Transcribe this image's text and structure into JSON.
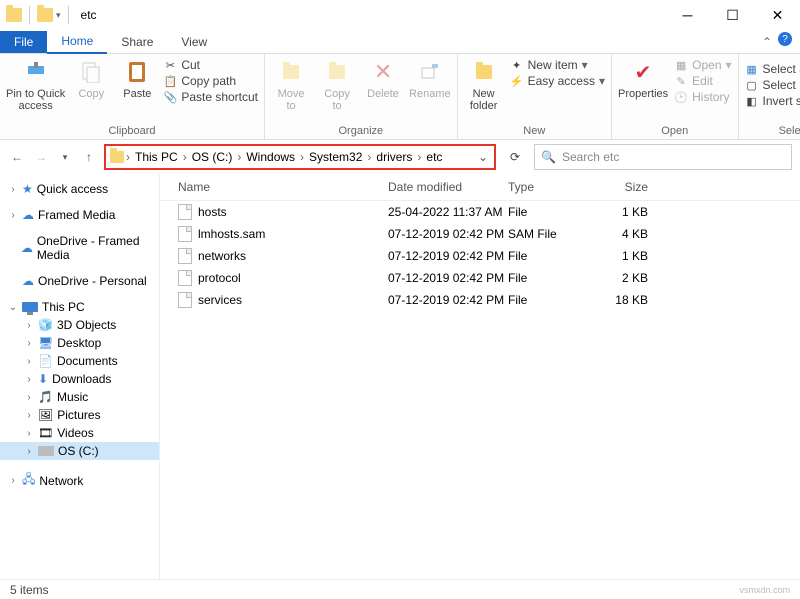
{
  "window": {
    "title": "etc"
  },
  "tabs": {
    "file": "File",
    "home": "Home",
    "share": "Share",
    "view": "View"
  },
  "ribbon": {
    "clipboard": {
      "label": "Clipboard",
      "pin": "Pin to Quick\naccess",
      "copy": "Copy",
      "paste": "Paste",
      "cut": "Cut",
      "copy_path": "Copy path",
      "paste_shortcut": "Paste shortcut"
    },
    "organize": {
      "label": "Organize",
      "move_to": "Move\nto",
      "copy_to": "Copy\nto",
      "delete": "Delete",
      "rename": "Rename"
    },
    "new": {
      "label": "New",
      "new_folder": "New\nfolder",
      "new_item": "New item",
      "easy_access": "Easy access"
    },
    "open": {
      "label": "Open",
      "properties": "Properties",
      "open": "Open",
      "edit": "Edit",
      "history": "History"
    },
    "select": {
      "label": "Select",
      "select_all": "Select all",
      "select_none": "Select none",
      "invert": "Invert selection"
    }
  },
  "breadcrumb": [
    "This PC",
    "OS (C:)",
    "Windows",
    "System32",
    "drivers",
    "etc"
  ],
  "search": {
    "placeholder": "Search etc"
  },
  "tree": {
    "quick_access": "Quick access",
    "framed_media": "Framed Media",
    "onedrive_framed": "OneDrive - Framed Media",
    "onedrive_personal": "OneDrive - Personal",
    "this_pc": "This PC",
    "objects3d": "3D Objects",
    "desktop": "Desktop",
    "documents": "Documents",
    "downloads": "Downloads",
    "music": "Music",
    "pictures": "Pictures",
    "videos": "Videos",
    "os_c": "OS (C:)",
    "network": "Network"
  },
  "columns": {
    "name": "Name",
    "date": "Date modified",
    "type": "Type",
    "size": "Size"
  },
  "files": [
    {
      "name": "hosts",
      "date": "25-04-2022 11:37 AM",
      "type": "File",
      "size": "1 KB"
    },
    {
      "name": "lmhosts.sam",
      "date": "07-12-2019 02:42 PM",
      "type": "SAM File",
      "size": "4 KB"
    },
    {
      "name": "networks",
      "date": "07-12-2019 02:42 PM",
      "type": "File",
      "size": "1 KB"
    },
    {
      "name": "protocol",
      "date": "07-12-2019 02:42 PM",
      "type": "File",
      "size": "2 KB"
    },
    {
      "name": "services",
      "date": "07-12-2019 02:42 PM",
      "type": "File",
      "size": "18 KB"
    }
  ],
  "status": {
    "items": "5 items",
    "watermark": "vsmxdn.com"
  }
}
